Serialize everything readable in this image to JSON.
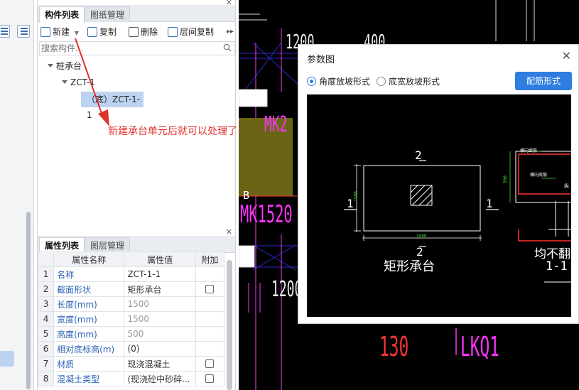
{
  "component_panel": {
    "tabs": [
      "构件列表",
      "图纸管理"
    ],
    "toolbar": {
      "new": "新建",
      "copy": "复制",
      "delete": "删除",
      "floor_copy": "层间复制"
    },
    "search_placeholder": "搜索构件...",
    "tree": {
      "root": "桩承台",
      "child": "ZCT-1",
      "leaf": "（底）ZCT-1-1"
    }
  },
  "property_panel": {
    "tabs": [
      "属性列表",
      "图层管理"
    ],
    "columns": [
      "属性名称",
      "属性值",
      "附加"
    ],
    "rows": [
      {
        "num": "1",
        "name": "名称",
        "value": "ZCT-1-1",
        "checkbox": false
      },
      {
        "num": "2",
        "name": "截面形状",
        "value": "矩形承台",
        "checkbox": true
      },
      {
        "num": "3",
        "name": "长度(mm)",
        "value": "1500",
        "checkbox": false
      },
      {
        "num": "4",
        "name": "宽度(mm)",
        "value": "1500",
        "checkbox": false
      },
      {
        "num": "5",
        "name": "高度(mm)",
        "value": "500",
        "checkbox": false
      },
      {
        "num": "6",
        "name": "相对底标高(m)",
        "value": "(0)",
        "checkbox": false
      },
      {
        "num": "7",
        "name": "材质",
        "value": "现浇混凝土",
        "checkbox": true
      },
      {
        "num": "8",
        "name": "混凝土类型",
        "value": "(现浇砼中砂碎...",
        "checkbox": true
      }
    ]
  },
  "annotation": "新建承台单元后就可以处理了",
  "cad": {
    "labels": {
      "dim_1200_top": "1200",
      "dim_400": "400",
      "mk2": "MK2",
      "b": "B",
      "mk1520": "MK1520",
      "dim_1200_mid": "1200",
      "n130": "130",
      "lkq1": "LKQ1"
    }
  },
  "dialog": {
    "title": "参数图",
    "radio_angle": "角度放坡形式",
    "radio_width": "底宽放坡形式",
    "rebar_button": "配筋形式",
    "drawing": {
      "num_top": "2",
      "num_bottom": "2",
      "num_left": "1",
      "num_right": "1",
      "dim_side": "1500",
      "dim_bottom": "1500",
      "caption": "矩形承台",
      "section_caption": "均不翻",
      "section_label": "1-1",
      "section_dim": "500",
      "label_a": "横向面筋",
      "label_b": "横向底筋",
      "label_c": "纵"
    }
  },
  "colors": {
    "accent": "#2f7de1",
    "annotation": "#e0322c",
    "cad_bg": "#000000",
    "cad_magenta": "#ff33ff",
    "cad_red": "#ff3333",
    "cad_blue": "#2a2ad0",
    "olive_block": "#6b6415"
  }
}
